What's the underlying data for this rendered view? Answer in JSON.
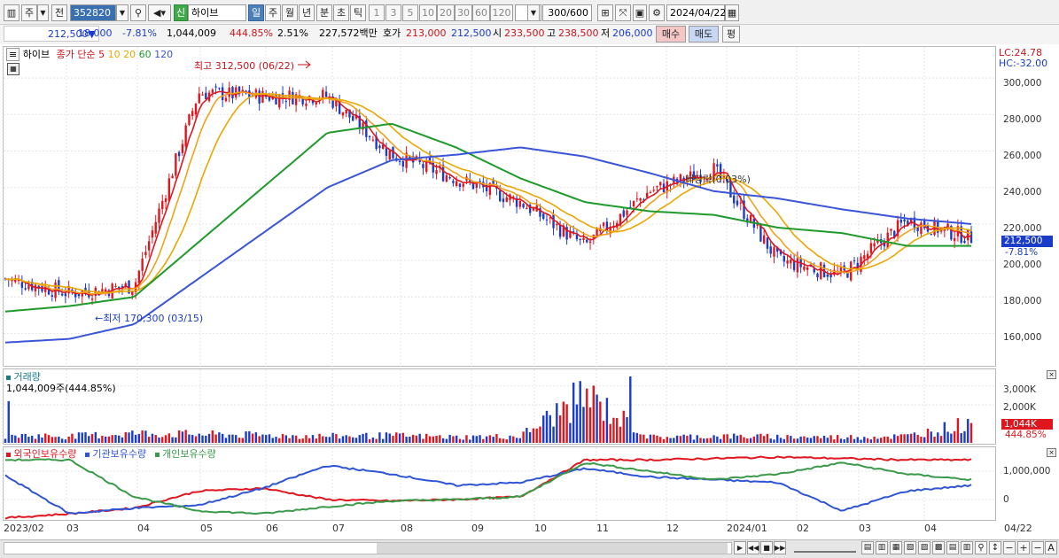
{
  "toolbar": {
    "chart_type": "주",
    "period_prefix": "전",
    "code": "352820",
    "badge": "신",
    "stock_name": "하이브",
    "periods": [
      "일",
      "주",
      "월",
      "년",
      "분",
      "초",
      "틱"
    ],
    "selected_period": "일",
    "intervals": [
      "1",
      "3",
      "5",
      "10",
      "20",
      "30",
      "60",
      "120"
    ],
    "count": "300",
    "count_max": "/600",
    "date": "2024/04/22",
    "icons": [
      "chart-type-icon",
      "search-icon",
      "sound-icon",
      "draw-icon",
      "cross-icon",
      "save-icon",
      "gear-icon",
      "calendar-icon"
    ]
  },
  "quote": {
    "price": "212,500",
    "change_arrow": "▼",
    "change": "18,000",
    "change_rate": "-7.81%",
    "volume": "1,044,009",
    "volume_rate": "444.85%",
    "turnover_rate": "2.51%",
    "amount": "227,572백만",
    "ask_label": "호가",
    "ask": "213,000",
    "bid": "212,500",
    "open_label": "시",
    "open": "233,500",
    "high_label": "고",
    "high": "238,500",
    "low_label": "저",
    "low": "206,000",
    "buy_label": "매수",
    "sell_label": "매도",
    "eval_label": "평"
  },
  "price_panel": {
    "name": "하이브",
    "legend_title": "종가 단순",
    "ma_labels": [
      "5",
      "10",
      "20",
      "60",
      "120"
    ],
    "max_label": "최고 312,500 (06/22)",
    "min_label": "←최저 170,300 (03/15)",
    "dividend_label": "배당락(0.03%)",
    "lc": "LC:24.78",
    "hc": "HC:-32.00",
    "current_price_tag": "212,500",
    "current_rate_tag": "-7.81%",
    "y_ticks": [
      "300,000",
      "280,000",
      "260,000",
      "240,000",
      "220,000",
      "200,000",
      "180,000",
      "160,000"
    ]
  },
  "volume_panel": {
    "title": "거래량",
    "value_label": "1,044,009주(444.85%)",
    "y_ticks": [
      "3,000K",
      "2,000K"
    ],
    "current_tag": "1,044K",
    "current_rate": "444.85%"
  },
  "holding_panel": {
    "legend": [
      "외국인보유수량",
      "기관보유수량",
      "개인보유수량"
    ],
    "y_ticks": [
      "1,000,000",
      "0"
    ]
  },
  "x_labels": [
    "2023/02",
    "03",
    "04",
    "05",
    "06",
    "07",
    "08",
    "09",
    "10",
    "11",
    "12",
    "2024/01",
    "02",
    "03",
    "04",
    "04/22"
  ],
  "colors": {
    "up": "#e0161e",
    "down": "#1a3cc8",
    "ma5": "#e0161e",
    "ma10": "#f2a21a",
    "ma20": "#e9a700",
    "ma60": "#1f9a2c",
    "ma120": "#3a55d8",
    "foreign": "#e0161e",
    "institution": "#2f55d4",
    "individual": "#3a9a4a"
  },
  "chart_data": [
    {
      "type": "line",
      "title": "",
      "xlabel": "",
      "ylabel": "",
      "ylim": [
        150000,
        320000
      ],
      "x": [
        "2023/02",
        "03",
        "04",
        "05",
        "06",
        "07",
        "08",
        "09",
        "10",
        "11",
        "12",
        "2024/01",
        "02",
        "03",
        "04",
        "04/22"
      ],
      "series": [
        {
          "name": "종가",
          "values": [
            190000,
            182000,
            186000,
            292000,
            290000,
            290000,
            258000,
            245000,
            232000,
            208000,
            238000,
            250000,
            200000,
            192000,
            222000,
            212500
          ]
        },
        {
          "name": "120",
          "values": [
            155000,
            157000,
            165000,
            190000,
            215000,
            240000,
            255000,
            258000,
            262000,
            257000,
            248000,
            238000,
            234000,
            228000,
            223000,
            220000
          ]
        },
        {
          "name": "60",
          "values": [
            172000,
            175000,
            180000,
            210000,
            240000,
            270000,
            275000,
            262000,
            245000,
            232000,
            227000,
            225000,
            218000,
            215000,
            208000,
            208000
          ]
        }
      ]
    },
    {
      "type": "bar",
      "title": "",
      "xlabel": "",
      "ylabel": "",
      "ylim": [
        0,
        3500000
      ],
      "x": [
        "2023/02",
        "03",
        "04",
        "05",
        "06",
        "07",
        "08",
        "09",
        "10",
        "11",
        "12",
        "2024/01",
        "02",
        "03",
        "04",
        "04/22"
      ],
      "values": [
        400000,
        350000,
        500000,
        450000,
        400000,
        350000,
        380000,
        300000,
        350000,
        2500000,
        300000,
        350000,
        320000,
        300000,
        350000,
        1044009
      ]
    },
    {
      "type": "line",
      "title": "",
      "xlabel": "",
      "ylabel": "",
      "ylim": [
        -700000,
        1600000
      ],
      "x": [
        "2023/02",
        "03",
        "04",
        "05",
        "06",
        "07",
        "08",
        "09",
        "10",
        "11",
        "12",
        "2024/01",
        "02",
        "03",
        "04",
        "04/22"
      ],
      "series": [
        {
          "name": "외국인보유수량",
          "values": [
            -650000,
            -500000,
            -300000,
            300000,
            400000,
            0,
            -50000,
            0,
            100000,
            1400000,
            1400000,
            1450000,
            1500000,
            1450000,
            1400000,
            1400000
          ]
        },
        {
          "name": "기관보유수량",
          "values": [
            850000,
            -500000,
            -300000,
            -200000,
            400000,
            1200000,
            900000,
            500000,
            600000,
            1100000,
            800000,
            700000,
            600000,
            -400000,
            300000,
            500000
          ]
        },
        {
          "name": "개인보유수량",
          "values": [
            1400000,
            1400000,
            100000,
            -400000,
            -500000,
            -250000,
            -50000,
            0,
            100000,
            1300000,
            1000000,
            700000,
            900000,
            1300000,
            900000,
            700000
          ]
        }
      ]
    }
  ]
}
